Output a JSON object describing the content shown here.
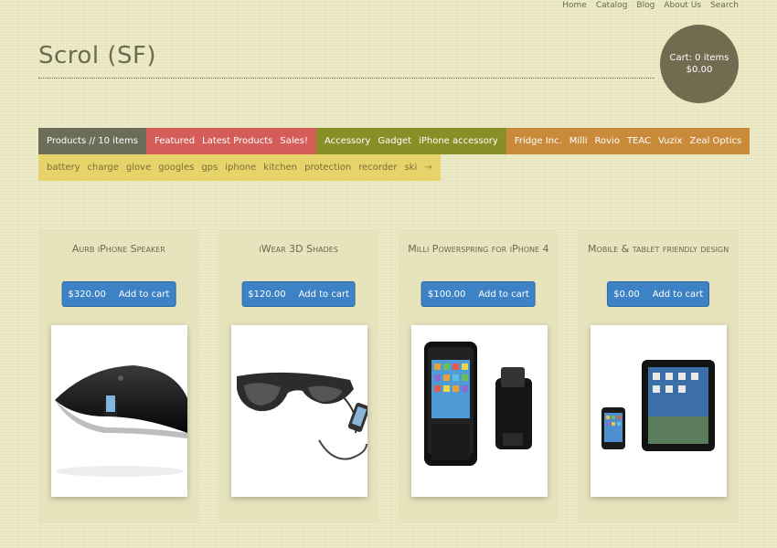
{
  "topnav": [
    "Home",
    "Catalog",
    "Blog",
    "About Us",
    "Search"
  ],
  "site": {
    "title": "Scrol (SF)"
  },
  "cart": {
    "line1": "Cart: 0 items",
    "line2": "$0.00"
  },
  "tags_row1": {
    "products": [
      "Products // 10 items"
    ],
    "featured": [
      "Featured",
      "Latest Products",
      "Sales!"
    ],
    "categories": [
      "Accessory",
      "Gadget",
      "iPhone accessory"
    ],
    "vendors": [
      "Fridge Inc.",
      "Milli",
      "Rovio",
      "TEAC",
      "Vuzix",
      "Zeal Optics"
    ]
  },
  "tags_row2": {
    "tags": [
      "battery",
      "charge",
      "glove",
      "googles",
      "gps",
      "iphone",
      "kitchen",
      "protection",
      "recorder",
      "ski"
    ],
    "more": "→"
  },
  "products": [
    {
      "title": "Aurb iPhone Speaker",
      "price": "$320.00",
      "action": "Add to cart",
      "image": "speaker-dock-image"
    },
    {
      "title": "iWear 3D Shades",
      "price": "$120.00",
      "action": "Add to cart",
      "image": "video-glasses-image"
    },
    {
      "title": "Milli Powerspring for iPhone 4",
      "price": "$100.00",
      "action": "Add to cart",
      "image": "battery-case-image"
    },
    {
      "title": "Mobile & tablet friendly design",
      "price": "$0.00",
      "action": "Add to cart",
      "image": "phone-tablet-image"
    }
  ],
  "colors": {
    "products": "#6b6d58",
    "featured": "#d45d5a",
    "categories": "#8a8e26",
    "vendors": "#c98a3a",
    "tags": "#e6d46a",
    "button": "#3c82c4",
    "cart": "#726b4f"
  }
}
